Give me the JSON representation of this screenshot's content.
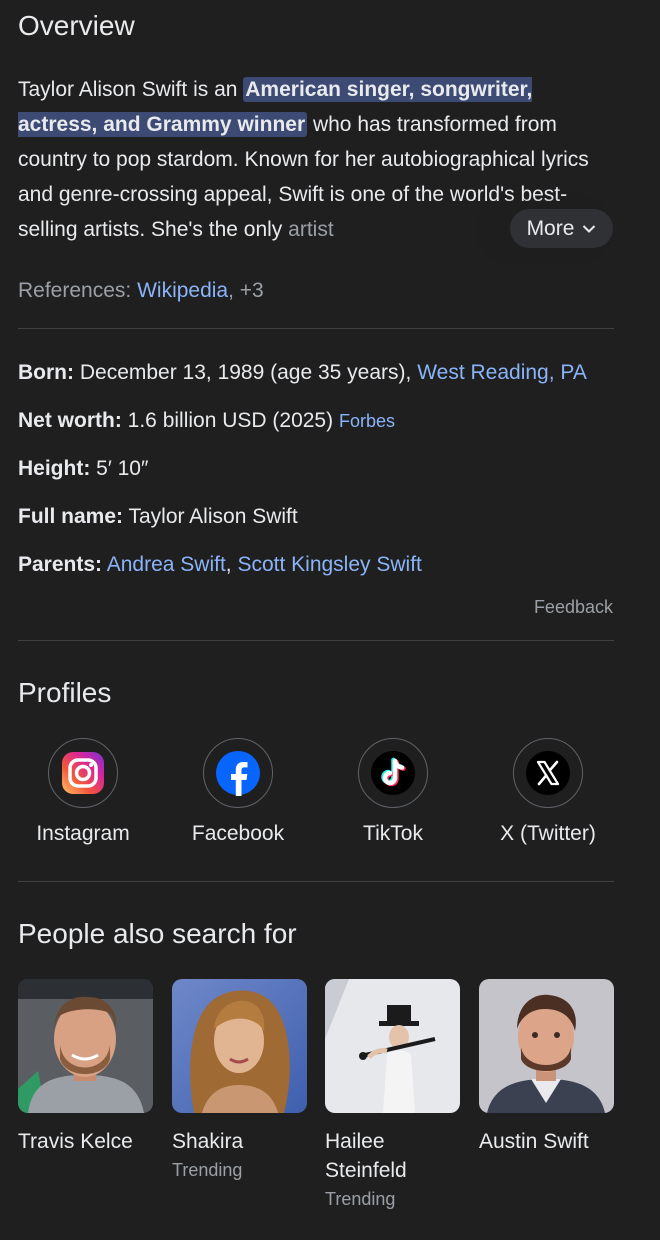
{
  "overview": {
    "title": "Overview",
    "text_before": "Taylor Alison Swift is an ",
    "highlight": "American singer, songwriter, actress, and Grammy winner",
    "text_after": " who has transformed from country to pop stardom. Known for her autobiographical lyrics and genre-crossing appeal, Swift is one of the world's best-selling artists. She's the only ",
    "text_fade": "artist",
    "more_label": "More"
  },
  "references": {
    "label": "References:",
    "link": "Wikipedia",
    "extra": ", +3"
  },
  "facts": {
    "born_label": "Born:",
    "born_value": "December 13, 1989 (age 35 years), ",
    "born_link": "West Reading, PA",
    "networth_label": "Net worth:",
    "networth_value": "1.6 billion USD (2025) ",
    "networth_source": "Forbes",
    "height_label": "Height:",
    "height_value": "5′ 10″",
    "fullname_label": "Full name:",
    "fullname_value": "Taylor Alison Swift",
    "parents_label": "Parents:",
    "parent1": "Andrea Swift",
    "parent_sep": ", ",
    "parent2": "Scott Kingsley Swift"
  },
  "feedback": "Feedback",
  "profiles": {
    "title": "Profiles",
    "items": [
      {
        "label": "Instagram",
        "icon": "instagram-icon"
      },
      {
        "label": "Facebook",
        "icon": "facebook-icon"
      },
      {
        "label": "TikTok",
        "icon": "tiktok-icon"
      },
      {
        "label": "X (Twitter)",
        "icon": "x-icon"
      }
    ]
  },
  "people": {
    "title": "People also search for",
    "items": [
      {
        "name": "Travis Kelce",
        "sub": ""
      },
      {
        "name": "Shakira",
        "sub": "Trending"
      },
      {
        "name": "Hailee Steinfeld",
        "sub": "Trending"
      },
      {
        "name": "Austin Swift",
        "sub": ""
      }
    ]
  },
  "colors": {
    "background": "#1f1f1f",
    "link": "#8ab4f8",
    "highlight": "#3c4a74",
    "muted": "#9aa0a6"
  }
}
